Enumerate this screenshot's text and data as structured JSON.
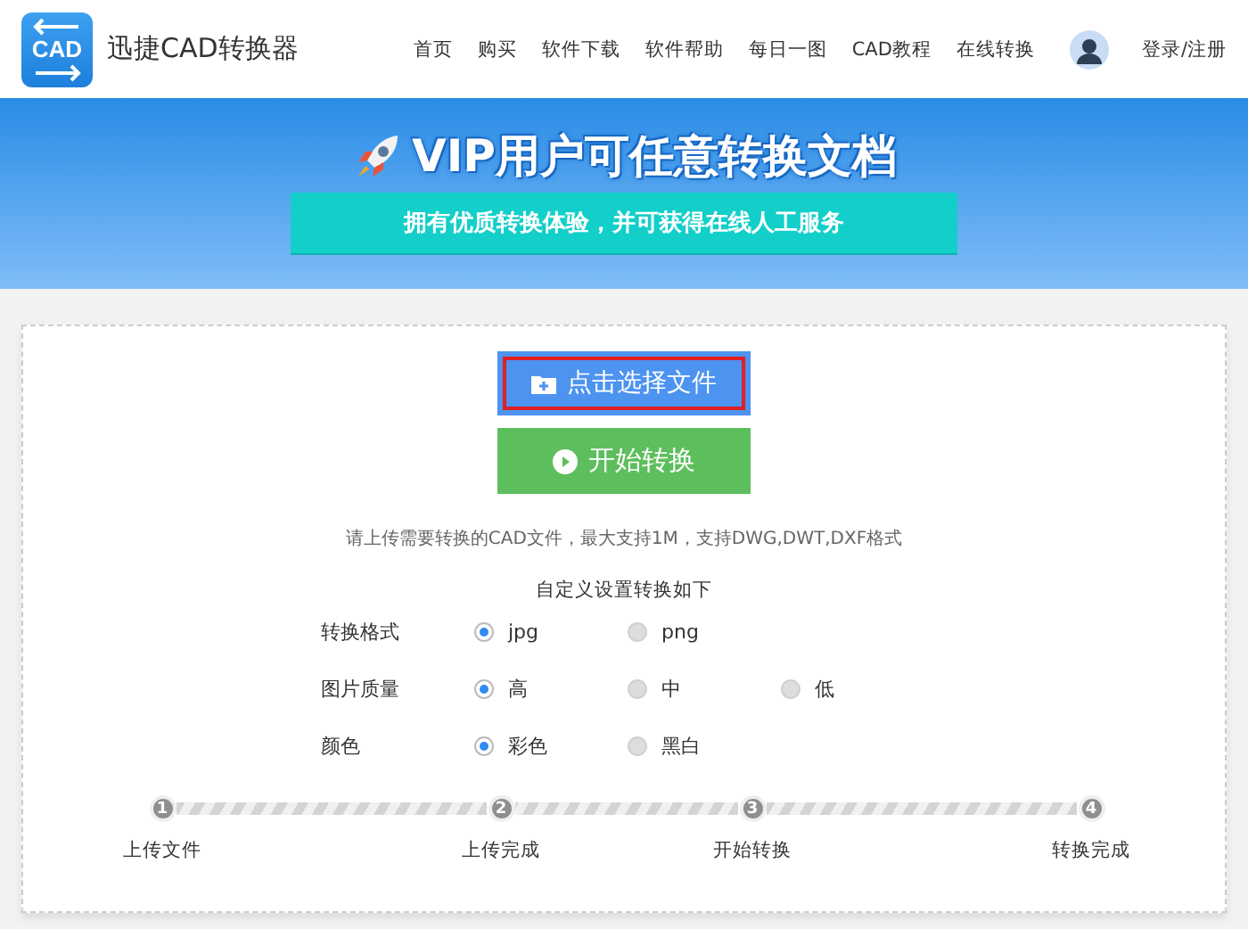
{
  "header": {
    "logo_text": "CAD",
    "site_name": "迅捷CAD转换器",
    "nav": [
      "首页",
      "购买",
      "软件下载",
      "软件帮助",
      "每日一图",
      "CAD教程",
      "在线转换"
    ],
    "login": "登录/注册"
  },
  "banner": {
    "title": "VIP用户可任意转换文档",
    "subtitle": "拥有优质转换体验，并可获得在线人工服务"
  },
  "upload": {
    "select_button": "点击选择文件",
    "convert_button": "开始转换",
    "hint": "请上传需要转换的CAD文件，最大支持1M，支持DWG,DWT,DXF格式",
    "settings_title": "自定义设置转换如下",
    "settings": [
      {
        "label": "转换格式",
        "options": [
          {
            "label": "jpg",
            "selected": true
          },
          {
            "label": "png",
            "selected": false
          }
        ]
      },
      {
        "label": "图片质量",
        "options": [
          {
            "label": "高",
            "selected": true
          },
          {
            "label": "中",
            "selected": false
          },
          {
            "label": "低",
            "selected": false
          }
        ]
      },
      {
        "label": "颜色",
        "options": [
          {
            "label": "彩色",
            "selected": true
          },
          {
            "label": "黑白",
            "selected": false
          }
        ]
      }
    ],
    "steps": [
      {
        "number": "1",
        "label": "上传文件"
      },
      {
        "number": "2",
        "label": "上传完成"
      },
      {
        "number": "3",
        "label": "开始转换"
      },
      {
        "number": "4",
        "label": "转换完成"
      }
    ]
  }
}
